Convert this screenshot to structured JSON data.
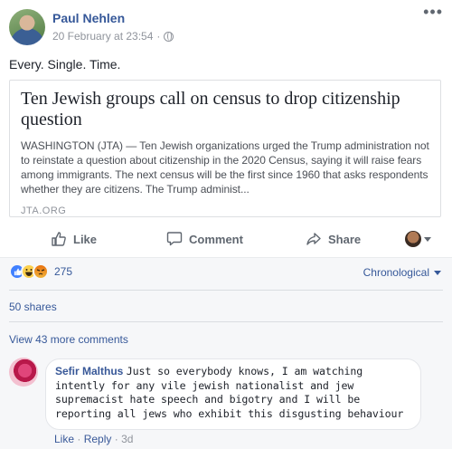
{
  "post": {
    "author": "Paul Nehlen",
    "timestamp": "20 February at 23:54",
    "separator": "·",
    "status_text": "Every. Single. Time.",
    "more_menu": "•••"
  },
  "link_card": {
    "title": "Ten Jewish groups call on census to drop citizenship question",
    "description": "WASHINGTON (JTA) — Ten Jewish organizations urged the Trump administration not to reinstate a question about citizenship in the 2020 Census, saying it will raise fears among immigrants. The next census will be the first since 1960 that asks respondents whether they are citizens. The Trump administ...",
    "domain": "JTA.ORG"
  },
  "actions": {
    "like": "Like",
    "comment": "Comment",
    "share": "Share"
  },
  "reactions": {
    "count": "275",
    "sort_label": "Chronological",
    "icons": [
      "like-reaction",
      "haha-reaction",
      "angry-reaction"
    ]
  },
  "shares": "50 shares",
  "view_more_comments": "View 43 more comments",
  "comment": {
    "author": "Sefir Malthus",
    "text": "Just so everybody knows, I am watching intently for any vile jewish nationalist and jew supremacist hate speech and bigotry and I will be reporting all jews who exhibit this disgusting behaviour",
    "like_label": "Like",
    "reply_label": "Reply",
    "age": "3d",
    "dot": "·"
  },
  "colors": {
    "link": "#365899",
    "muted": "#90949c",
    "like_blue": "#4080ff"
  }
}
